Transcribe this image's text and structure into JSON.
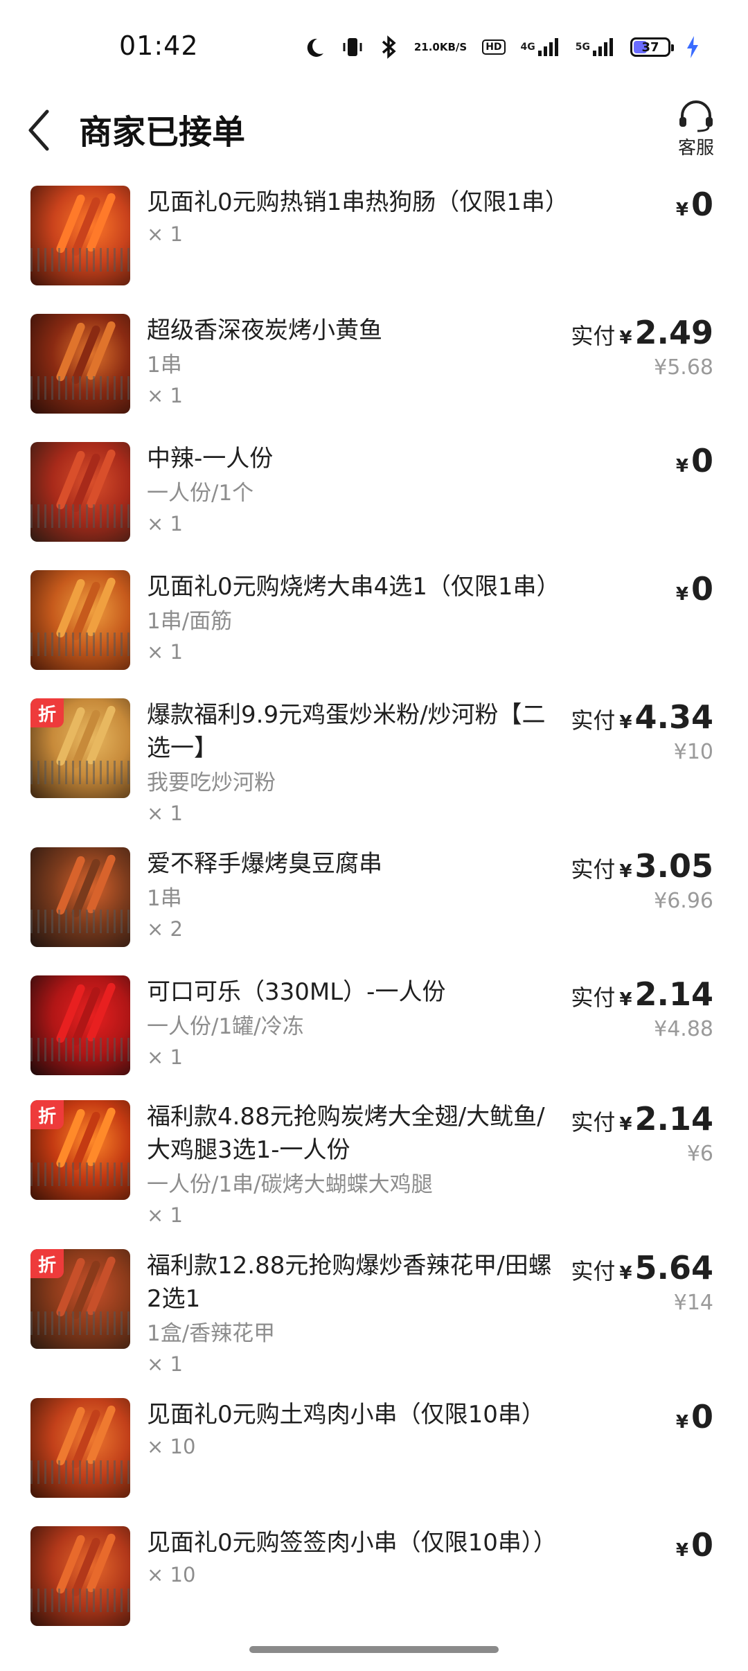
{
  "status_bar": {
    "time": "01:42",
    "net_speed_value": "21.0",
    "net_speed_unit": "KB/S",
    "hd_label": "HD",
    "network_4g": "4G",
    "network_5g": "5G",
    "battery_level": "37",
    "battery_fraction": 0.37
  },
  "header": {
    "title": "商家已接单",
    "service_label": "客服",
    "back_icon": "chevron-left-icon",
    "service_icon": "headset-icon"
  },
  "items": [
    {
      "name": "见面礼0元购热销1串热狗肠（仅限1串）",
      "spec": "",
      "qty": "× 1",
      "paid_label": "",
      "currency": "¥",
      "price": "0",
      "original_price": "",
      "discount_tag": ""
    },
    {
      "name": "超级香深夜炭烤小黄鱼",
      "spec": "1串",
      "qty": "× 1",
      "paid_label": "实付",
      "currency": "¥",
      "price": "2.49",
      "original_price": "¥5.68",
      "discount_tag": ""
    },
    {
      "name": "中辣-一人份",
      "spec": "一人份/1个",
      "qty": "× 1",
      "paid_label": "",
      "currency": "¥",
      "price": "0",
      "original_price": "",
      "discount_tag": ""
    },
    {
      "name": "见面礼0元购烧烤大串4选1（仅限1串）",
      "spec": "1串/面筋",
      "qty": "× 1",
      "paid_label": "",
      "currency": "¥",
      "price": "0",
      "original_price": "",
      "discount_tag": ""
    },
    {
      "name": "爆款福利9.9元鸡蛋炒米粉/炒河粉【二选一】",
      "spec": "我要吃炒河粉",
      "qty": "× 1",
      "paid_label": "实付",
      "currency": "¥",
      "price": "4.34",
      "original_price": "¥10",
      "discount_tag": "折"
    },
    {
      "name": "爱不释手爆烤臭豆腐串",
      "spec": "1串",
      "qty": "× 2",
      "paid_label": "实付",
      "currency": "¥",
      "price": "3.05",
      "original_price": "¥6.96",
      "discount_tag": ""
    },
    {
      "name": "可口可乐（330ML）-一人份",
      "spec": "一人份/1罐/冷冻",
      "qty": "× 1",
      "paid_label": "实付",
      "currency": "¥",
      "price": "2.14",
      "original_price": "¥4.88",
      "discount_tag": ""
    },
    {
      "name": "福利款4.88元抢购炭烤大全翅/大鱿鱼/大鸡腿3选1-一人份",
      "spec": "一人份/1串/碳烤大蝴蝶大鸡腿",
      "qty": "× 1",
      "paid_label": "实付",
      "currency": "¥",
      "price": "2.14",
      "original_price": "¥6",
      "discount_tag": "折"
    },
    {
      "name": "福利款12.88元抢购爆炒香辣花甲/田螺2选1",
      "spec": "1盒/香辣花甲",
      "qty": "× 1",
      "paid_label": "实付",
      "currency": "¥",
      "price": "5.64",
      "original_price": "¥14",
      "discount_tag": "折"
    },
    {
      "name": "见面礼0元购土鸡肉小串（仅限10串）",
      "spec": "",
      "qty": "× 10",
      "paid_label": "",
      "currency": "¥",
      "price": "0",
      "original_price": "",
      "discount_tag": ""
    },
    {
      "name": "见面礼0元购签签肉小串（仅限10串））",
      "spec": "",
      "qty": "× 10",
      "paid_label": "",
      "currency": "¥",
      "price": "0",
      "original_price": "",
      "discount_tag": ""
    }
  ]
}
